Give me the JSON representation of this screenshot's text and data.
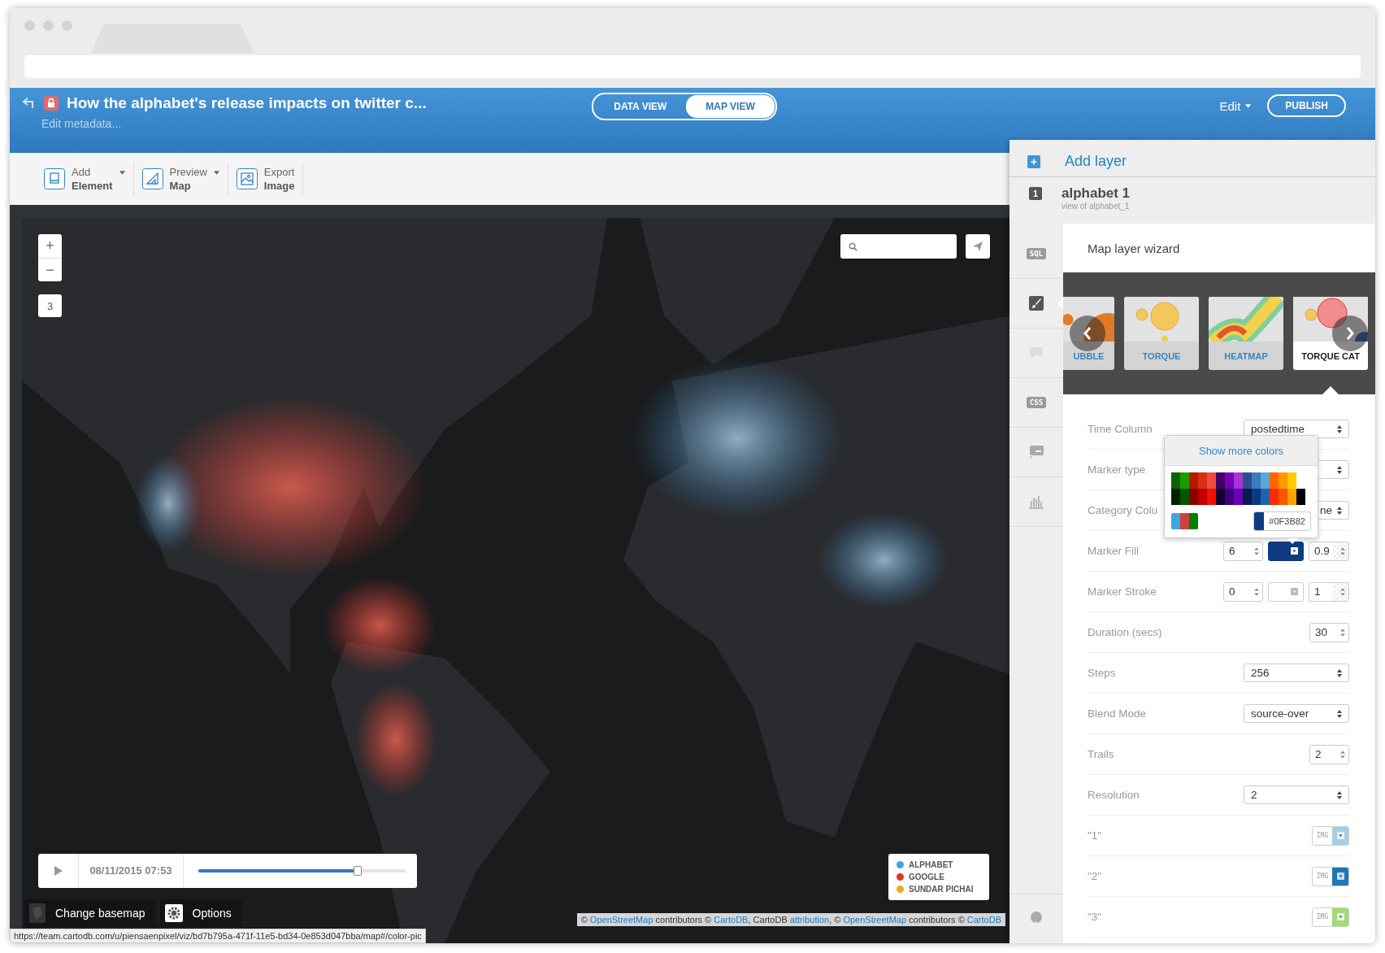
{
  "header": {
    "title": "How the alphabet's release impacts on twitter c...",
    "subtitle": "Edit metadata...",
    "view_toggle": [
      {
        "label": "DATA VIEW",
        "selected": false
      },
      {
        "label": "MAP VIEW",
        "selected": true
      }
    ],
    "edit_menu": "Edit",
    "publish": "PUBLISH"
  },
  "toolbar": [
    {
      "kind": "element",
      "line1": "Add",
      "line2": "Element",
      "dropdown": true
    },
    {
      "kind": "preview",
      "line1": "Preview",
      "line2": "Map",
      "dropdown": true
    },
    {
      "kind": "export",
      "line1": "Export",
      "line2": "Image",
      "dropdown": false
    }
  ],
  "map": {
    "zoom_in": "+",
    "zoom_out": "−",
    "zoom_level": "3",
    "timeline": {
      "date": "08/11/2015 07:53",
      "level": 0.77
    },
    "legend": [
      {
        "label": "ALPHABET",
        "color": "#3ea6e0"
      },
      {
        "label": "GOOGLE",
        "color": "#d9392b"
      },
      {
        "label": "SUNDAR PICHAI",
        "color": "#f5a623"
      }
    ],
    "basemap_button": "Change basemap",
    "options_button": "Options",
    "attribution": [
      {
        "kind": "text",
        "text": "© "
      },
      {
        "kind": "link",
        "text": "OpenStreetMap"
      },
      {
        "kind": "text",
        "text": " contributors © "
      },
      {
        "kind": "link",
        "text": "CartoDB"
      },
      {
        "kind": "text",
        "text": ", CartoDB "
      },
      {
        "kind": "link",
        "text": "attribution"
      },
      {
        "kind": "text",
        "text": ", © "
      },
      {
        "kind": "link",
        "text": "OpenStreetMap"
      },
      {
        "kind": "text",
        "text": " contributors © "
      },
      {
        "kind": "link",
        "text": "CartoDB"
      }
    ]
  },
  "status_url": "https://team.cartodb.com/u/piensaenpixel/viz/bd7b795a-471f-11e5-bd34-0e853d047bba/map#/color-pic",
  "panel": {
    "add_layer": "Add layer",
    "layer": {
      "number": "1",
      "name": "alphabet 1",
      "source": "view of alphabet_1"
    },
    "sidebar": [
      {
        "kind": "sql",
        "label": "SQL",
        "selected": false,
        "disabled": false
      },
      {
        "kind": "brush",
        "selected": true,
        "disabled": false
      },
      {
        "kind": "comment",
        "selected": false,
        "disabled": true
      },
      {
        "kind": "css",
        "label": "CSS",
        "selected": false,
        "disabled": false
      },
      {
        "kind": "legend",
        "selected": false,
        "disabled": false
      },
      {
        "kind": "chart",
        "selected": false,
        "disabled": false
      },
      {
        "kind": "pin",
        "selected": false,
        "disabled": false
      }
    ]
  },
  "wizard": {
    "title": "Map layer wizard",
    "types": [
      {
        "kind": "bubble",
        "label": "UBBLE",
        "selected": false
      },
      {
        "kind": "torque",
        "label": "TORQUE",
        "selected": false
      },
      {
        "kind": "heatmap",
        "label": "HEATMAP",
        "selected": false
      },
      {
        "kind": "torquecat",
        "label": "TORQUE CAT",
        "selected": true
      }
    ],
    "rows": [
      {
        "kind": "select",
        "label": "Time Column",
        "value": "postedtime"
      },
      {
        "kind": "select",
        "label": "Marker type"
      },
      {
        "kind": "select",
        "label": "Category Colu",
        "value": "ne",
        "covered": true
      },
      {
        "kind": "fill",
        "label": "Marker Fill",
        "size": "6",
        "color": "#0f3b82",
        "opacity": "0.9"
      },
      {
        "kind": "fill",
        "label": "Marker Stroke",
        "size": "0",
        "opacity": "1"
      },
      {
        "kind": "number",
        "label": "Duration (secs)",
        "value": "30"
      },
      {
        "kind": "select",
        "label": "Steps",
        "value": "256"
      },
      {
        "kind": "select",
        "label": "Blend Mode",
        "value": "source-over"
      },
      {
        "kind": "number",
        "label": "Trails",
        "value": "2"
      },
      {
        "kind": "select",
        "label": "Resolution",
        "value": "2"
      },
      {
        "kind": "category",
        "label": "\"1\"",
        "image": "IMG",
        "color": "#a6cee3"
      },
      {
        "kind": "category",
        "label": "\"2\"",
        "image": "IMG",
        "color": "#1f78b4"
      },
      {
        "kind": "category",
        "label": "\"3\"",
        "image": "IMG",
        "color": "#a3d977"
      }
    ],
    "color_picker": {
      "link": "Show more colors",
      "palette": [
        {
          "colors": [
            {
              "color": "#0b6400"
            },
            {
              "color": "#1a9c00"
            },
            {
              "color": "#b81800"
            },
            {
              "color": "#d93012"
            },
            {
              "color": "#f24b3d"
            },
            {
              "color": "#3d0066"
            },
            {
              "color": "#7a00b3"
            },
            {
              "color": "#a733d9"
            },
            {
              "color": "#2b4f8a"
            },
            {
              "color": "#3b7bc0"
            },
            {
              "color": "#5ba3d8"
            },
            {
              "color": "#ff6600"
            },
            {
              "color": "#ff9900"
            },
            {
              "color": "#ffcc00"
            }
          ]
        },
        {
          "colors": [
            {
              "color": "#002200"
            },
            {
              "color": "#005500"
            },
            {
              "color": "#880000"
            },
            {
              "color": "#c00000"
            },
            {
              "color": "#f21000"
            },
            {
              "color": "#150033"
            },
            {
              "color": "#3d0080"
            },
            {
              "color": "#6a00b3"
            },
            {
              "color": "#0a1a4d"
            },
            {
              "color": "#0a3a80"
            },
            {
              "color": "#1e63b0"
            },
            {
              "color": "#ff2a00"
            },
            {
              "color": "#ff5500"
            },
            {
              "color": "#ffa200"
            },
            {
              "color": "#000000"
            }
          ]
        }
      ],
      "ramp": [
        {
          "color": "#3ea6e0"
        },
        {
          "color": "#d0413a"
        },
        {
          "color": "#008000"
        }
      ],
      "hex": "#0F3B82"
    }
  }
}
